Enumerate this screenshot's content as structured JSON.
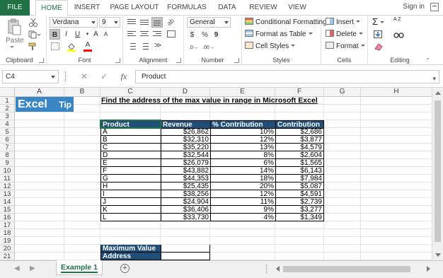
{
  "ribbon_tabs": [
    "FILE",
    "HOME",
    "INSERT",
    "PAGE LAYOUT",
    "FORMULAS",
    "DATA",
    "REVIEW",
    "VIEW"
  ],
  "active_tab": "HOME",
  "signin": "Sign in",
  "clipboard": {
    "paste_label": "Paste",
    "group_label": "Clipboard"
  },
  "font": {
    "name": "Verdana",
    "size": "9",
    "group_label": "Font",
    "bold": "B",
    "italic": "I",
    "underline": "U",
    "grow": "A",
    "shrink": "A"
  },
  "alignment": {
    "group_label": "Alignment"
  },
  "number": {
    "format": "General",
    "currency": "$",
    "percent": "%",
    "comma": "9",
    "group_label": "Number"
  },
  "styles": {
    "conditional": "Conditional Formatting",
    "format_table": "Format as Table",
    "cell_styles": "Cell Styles",
    "group_label": "Styles"
  },
  "cells": {
    "insert": "Insert",
    "delete": "Delete",
    "format": "Format",
    "group_label": "Cells"
  },
  "editing": {
    "group_label": "Editing",
    "sum": "Σ",
    "sort": "A Z"
  },
  "formula_bar": {
    "name_box": "C4",
    "fx": "fx",
    "cancel": "✕",
    "enter": "✓",
    "content": "Product"
  },
  "columns": [
    "A",
    "B",
    "C",
    "D",
    "E",
    "F",
    "G",
    "H"
  ],
  "rows": [
    "1",
    "2",
    "3",
    "4",
    "5",
    "6",
    "7",
    "8",
    "9",
    "10",
    "11",
    "12",
    "13",
    "14",
    "15",
    "16",
    "17",
    "18",
    "19",
    "20",
    "21"
  ],
  "logo": {
    "big": "Excel",
    "small": "Tip"
  },
  "sheet_title": "Find the address of the max value in range in Microsoft Excel",
  "table": {
    "headers": [
      "Product",
      "Revenue",
      "% Contribution",
      "Contribution"
    ],
    "rows": [
      [
        "A",
        "$26,862",
        "10%",
        "$2,686"
      ],
      [
        "B",
        "$32,310",
        "12%",
        "$3,877"
      ],
      [
        "C",
        "$35,220",
        "13%",
        "$4,579"
      ],
      [
        "D",
        "$32,544",
        "8%",
        "$2,604"
      ],
      [
        "E",
        "$26,079",
        "6%",
        "$1,565"
      ],
      [
        "F",
        "$43,882",
        "14%",
        "$6,143"
      ],
      [
        "G",
        "$44,353",
        "18%",
        "$7,984"
      ],
      [
        "H",
        "$25,435",
        "20%",
        "$5,087"
      ],
      [
        "I",
        "$38,256",
        "12%",
        "$4,591"
      ],
      [
        "J",
        "$24,904",
        "11%",
        "$2,739"
      ],
      [
        "K",
        "$36,406",
        "9%",
        "$3,277"
      ],
      [
        "L",
        "$33,730",
        "4%",
        "$1,349"
      ]
    ]
  },
  "summary": {
    "max_label": "Maximum Value",
    "max_value": "",
    "address_label": "Address",
    "address_value": ""
  },
  "sheet_tab": "Example 1",
  "colors": {
    "excel_green": "#217346",
    "header_blue": "#1f4e79",
    "logo_blue": "#3a86c4"
  }
}
